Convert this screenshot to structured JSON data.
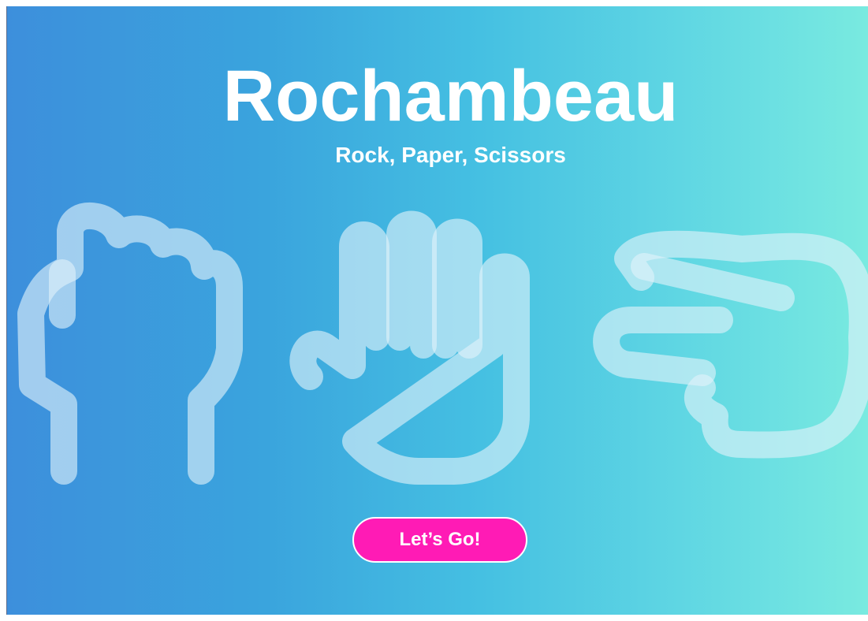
{
  "header": {
    "title": "Rochambeau",
    "subtitle": "Rock, Paper, Scissors"
  },
  "hands": [
    {
      "name": "rock",
      "icon": "rock-fist-icon"
    },
    {
      "name": "paper",
      "icon": "paper-open-hand-icon"
    },
    {
      "name": "scissors",
      "icon": "scissors-hand-icon"
    }
  ],
  "actions": {
    "go_label": "Let’s Go!"
  },
  "colors": {
    "gradient_start": "#3d8fdc",
    "gradient_end": "#79eae0",
    "button": "#ff1bb5",
    "text": "#ffffff"
  }
}
